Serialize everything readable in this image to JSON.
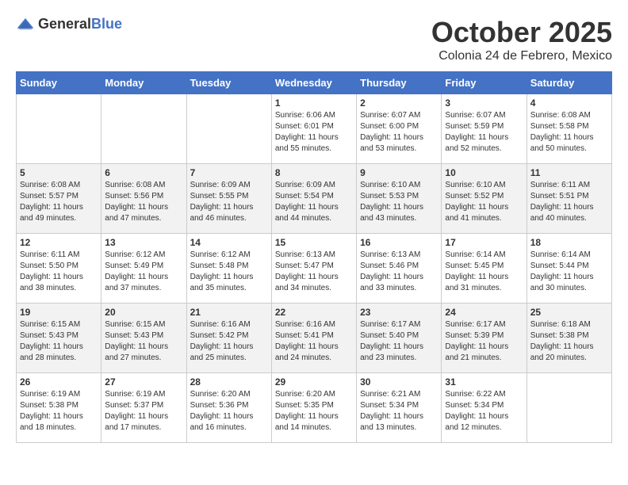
{
  "header": {
    "logo_general": "General",
    "logo_blue": "Blue",
    "month_title": "October 2025",
    "location": "Colonia 24 de Febrero, Mexico"
  },
  "weekdays": [
    "Sunday",
    "Monday",
    "Tuesday",
    "Wednesday",
    "Thursday",
    "Friday",
    "Saturday"
  ],
  "weeks": [
    [
      {
        "day": "",
        "sunrise": "",
        "sunset": "",
        "daylight": ""
      },
      {
        "day": "",
        "sunrise": "",
        "sunset": "",
        "daylight": ""
      },
      {
        "day": "",
        "sunrise": "",
        "sunset": "",
        "daylight": ""
      },
      {
        "day": "1",
        "sunrise": "Sunrise: 6:06 AM",
        "sunset": "Sunset: 6:01 PM",
        "daylight": "Daylight: 11 hours and 55 minutes."
      },
      {
        "day": "2",
        "sunrise": "Sunrise: 6:07 AM",
        "sunset": "Sunset: 6:00 PM",
        "daylight": "Daylight: 11 hours and 53 minutes."
      },
      {
        "day": "3",
        "sunrise": "Sunrise: 6:07 AM",
        "sunset": "Sunset: 5:59 PM",
        "daylight": "Daylight: 11 hours and 52 minutes."
      },
      {
        "day": "4",
        "sunrise": "Sunrise: 6:08 AM",
        "sunset": "Sunset: 5:58 PM",
        "daylight": "Daylight: 11 hours and 50 minutes."
      }
    ],
    [
      {
        "day": "5",
        "sunrise": "Sunrise: 6:08 AM",
        "sunset": "Sunset: 5:57 PM",
        "daylight": "Daylight: 11 hours and 49 minutes."
      },
      {
        "day": "6",
        "sunrise": "Sunrise: 6:08 AM",
        "sunset": "Sunset: 5:56 PM",
        "daylight": "Daylight: 11 hours and 47 minutes."
      },
      {
        "day": "7",
        "sunrise": "Sunrise: 6:09 AM",
        "sunset": "Sunset: 5:55 PM",
        "daylight": "Daylight: 11 hours and 46 minutes."
      },
      {
        "day": "8",
        "sunrise": "Sunrise: 6:09 AM",
        "sunset": "Sunset: 5:54 PM",
        "daylight": "Daylight: 11 hours and 44 minutes."
      },
      {
        "day": "9",
        "sunrise": "Sunrise: 6:10 AM",
        "sunset": "Sunset: 5:53 PM",
        "daylight": "Daylight: 11 hours and 43 minutes."
      },
      {
        "day": "10",
        "sunrise": "Sunrise: 6:10 AM",
        "sunset": "Sunset: 5:52 PM",
        "daylight": "Daylight: 11 hours and 41 minutes."
      },
      {
        "day": "11",
        "sunrise": "Sunrise: 6:11 AM",
        "sunset": "Sunset: 5:51 PM",
        "daylight": "Daylight: 11 hours and 40 minutes."
      }
    ],
    [
      {
        "day": "12",
        "sunrise": "Sunrise: 6:11 AM",
        "sunset": "Sunset: 5:50 PM",
        "daylight": "Daylight: 11 hours and 38 minutes."
      },
      {
        "day": "13",
        "sunrise": "Sunrise: 6:12 AM",
        "sunset": "Sunset: 5:49 PM",
        "daylight": "Daylight: 11 hours and 37 minutes."
      },
      {
        "day": "14",
        "sunrise": "Sunrise: 6:12 AM",
        "sunset": "Sunset: 5:48 PM",
        "daylight": "Daylight: 11 hours and 35 minutes."
      },
      {
        "day": "15",
        "sunrise": "Sunrise: 6:13 AM",
        "sunset": "Sunset: 5:47 PM",
        "daylight": "Daylight: 11 hours and 34 minutes."
      },
      {
        "day": "16",
        "sunrise": "Sunrise: 6:13 AM",
        "sunset": "Sunset: 5:46 PM",
        "daylight": "Daylight: 11 hours and 33 minutes."
      },
      {
        "day": "17",
        "sunrise": "Sunrise: 6:14 AM",
        "sunset": "Sunset: 5:45 PM",
        "daylight": "Daylight: 11 hours and 31 minutes."
      },
      {
        "day": "18",
        "sunrise": "Sunrise: 6:14 AM",
        "sunset": "Sunset: 5:44 PM",
        "daylight": "Daylight: 11 hours and 30 minutes."
      }
    ],
    [
      {
        "day": "19",
        "sunrise": "Sunrise: 6:15 AM",
        "sunset": "Sunset: 5:43 PM",
        "daylight": "Daylight: 11 hours and 28 minutes."
      },
      {
        "day": "20",
        "sunrise": "Sunrise: 6:15 AM",
        "sunset": "Sunset: 5:43 PM",
        "daylight": "Daylight: 11 hours and 27 minutes."
      },
      {
        "day": "21",
        "sunrise": "Sunrise: 6:16 AM",
        "sunset": "Sunset: 5:42 PM",
        "daylight": "Daylight: 11 hours and 25 minutes."
      },
      {
        "day": "22",
        "sunrise": "Sunrise: 6:16 AM",
        "sunset": "Sunset: 5:41 PM",
        "daylight": "Daylight: 11 hours and 24 minutes."
      },
      {
        "day": "23",
        "sunrise": "Sunrise: 6:17 AM",
        "sunset": "Sunset: 5:40 PM",
        "daylight": "Daylight: 11 hours and 23 minutes."
      },
      {
        "day": "24",
        "sunrise": "Sunrise: 6:17 AM",
        "sunset": "Sunset: 5:39 PM",
        "daylight": "Daylight: 11 hours and 21 minutes."
      },
      {
        "day": "25",
        "sunrise": "Sunrise: 6:18 AM",
        "sunset": "Sunset: 5:38 PM",
        "daylight": "Daylight: 11 hours and 20 minutes."
      }
    ],
    [
      {
        "day": "26",
        "sunrise": "Sunrise: 6:19 AM",
        "sunset": "Sunset: 5:38 PM",
        "daylight": "Daylight: 11 hours and 18 minutes."
      },
      {
        "day": "27",
        "sunrise": "Sunrise: 6:19 AM",
        "sunset": "Sunset: 5:37 PM",
        "daylight": "Daylight: 11 hours and 17 minutes."
      },
      {
        "day": "28",
        "sunrise": "Sunrise: 6:20 AM",
        "sunset": "Sunset: 5:36 PM",
        "daylight": "Daylight: 11 hours and 16 minutes."
      },
      {
        "day": "29",
        "sunrise": "Sunrise: 6:20 AM",
        "sunset": "Sunset: 5:35 PM",
        "daylight": "Daylight: 11 hours and 14 minutes."
      },
      {
        "day": "30",
        "sunrise": "Sunrise: 6:21 AM",
        "sunset": "Sunset: 5:34 PM",
        "daylight": "Daylight: 11 hours and 13 minutes."
      },
      {
        "day": "31",
        "sunrise": "Sunrise: 6:22 AM",
        "sunset": "Sunset: 5:34 PM",
        "daylight": "Daylight: 11 hours and 12 minutes."
      },
      {
        "day": "",
        "sunrise": "",
        "sunset": "",
        "daylight": ""
      }
    ]
  ]
}
